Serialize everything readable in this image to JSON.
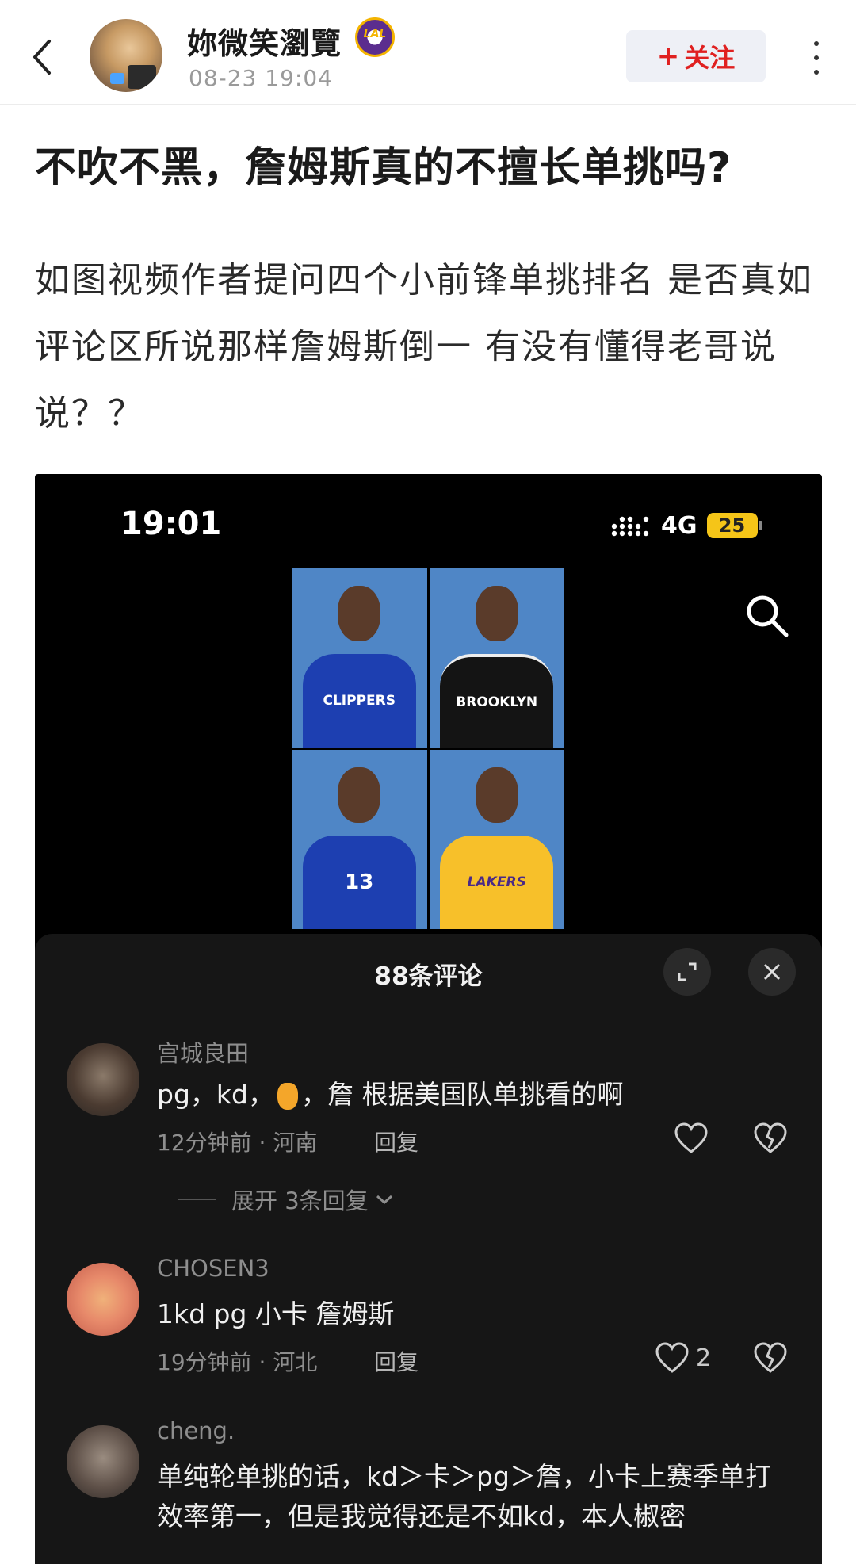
{
  "header": {
    "back_icon": "chevron-left-icon",
    "username": "妳微笑瀏覽",
    "badge_text": "LAL",
    "post_time": "08-23 19:04",
    "follow_plus": "+",
    "follow_label": "关注",
    "more_icon": "more-vertical-icon"
  },
  "post": {
    "title": "不吹不黑，詹姆斯真的不擅长单挑吗?",
    "body": "如图视频作者提问四个小前锋单挑排名 是否真如评论区所说那样詹姆斯倒一 有没有懂得老哥说说？？"
  },
  "screenshot": {
    "status_time": "19:01",
    "network": "4G",
    "battery": "25",
    "players": [
      {
        "jersey": "CLIPPERS"
      },
      {
        "jersey": "BROOKLYN"
      },
      {
        "jersey": "13"
      },
      {
        "jersey": "LAKERS"
      }
    ],
    "comments_panel": {
      "title": "88条评论",
      "comments": [
        {
          "username": "宫城良田",
          "text_before": "pg，kd，",
          "text_after": "，詹 根据美国队单挑看的啊",
          "meta": "12分钟前 · 河南",
          "reply_label": "回复",
          "likes": "",
          "expand_replies": "展开 3条回复"
        },
        {
          "username": "CHOSEN3",
          "text": "1kd pg 小卡 詹姆斯",
          "meta": "19分钟前 · 河北",
          "reply_label": "回复",
          "likes": "2"
        },
        {
          "username": "cheng.",
          "text": "单纯轮单挑的话，kd＞卡＞pg＞詹，小卡上赛季单打效率第一，但是我觉得还是不如kd，本人椒密"
        }
      ]
    }
  },
  "colors": {
    "follow_text": "#e02020",
    "follow_bg": "#eef0f6",
    "sheet_bg": "#161616",
    "battery": "#f5c518"
  }
}
